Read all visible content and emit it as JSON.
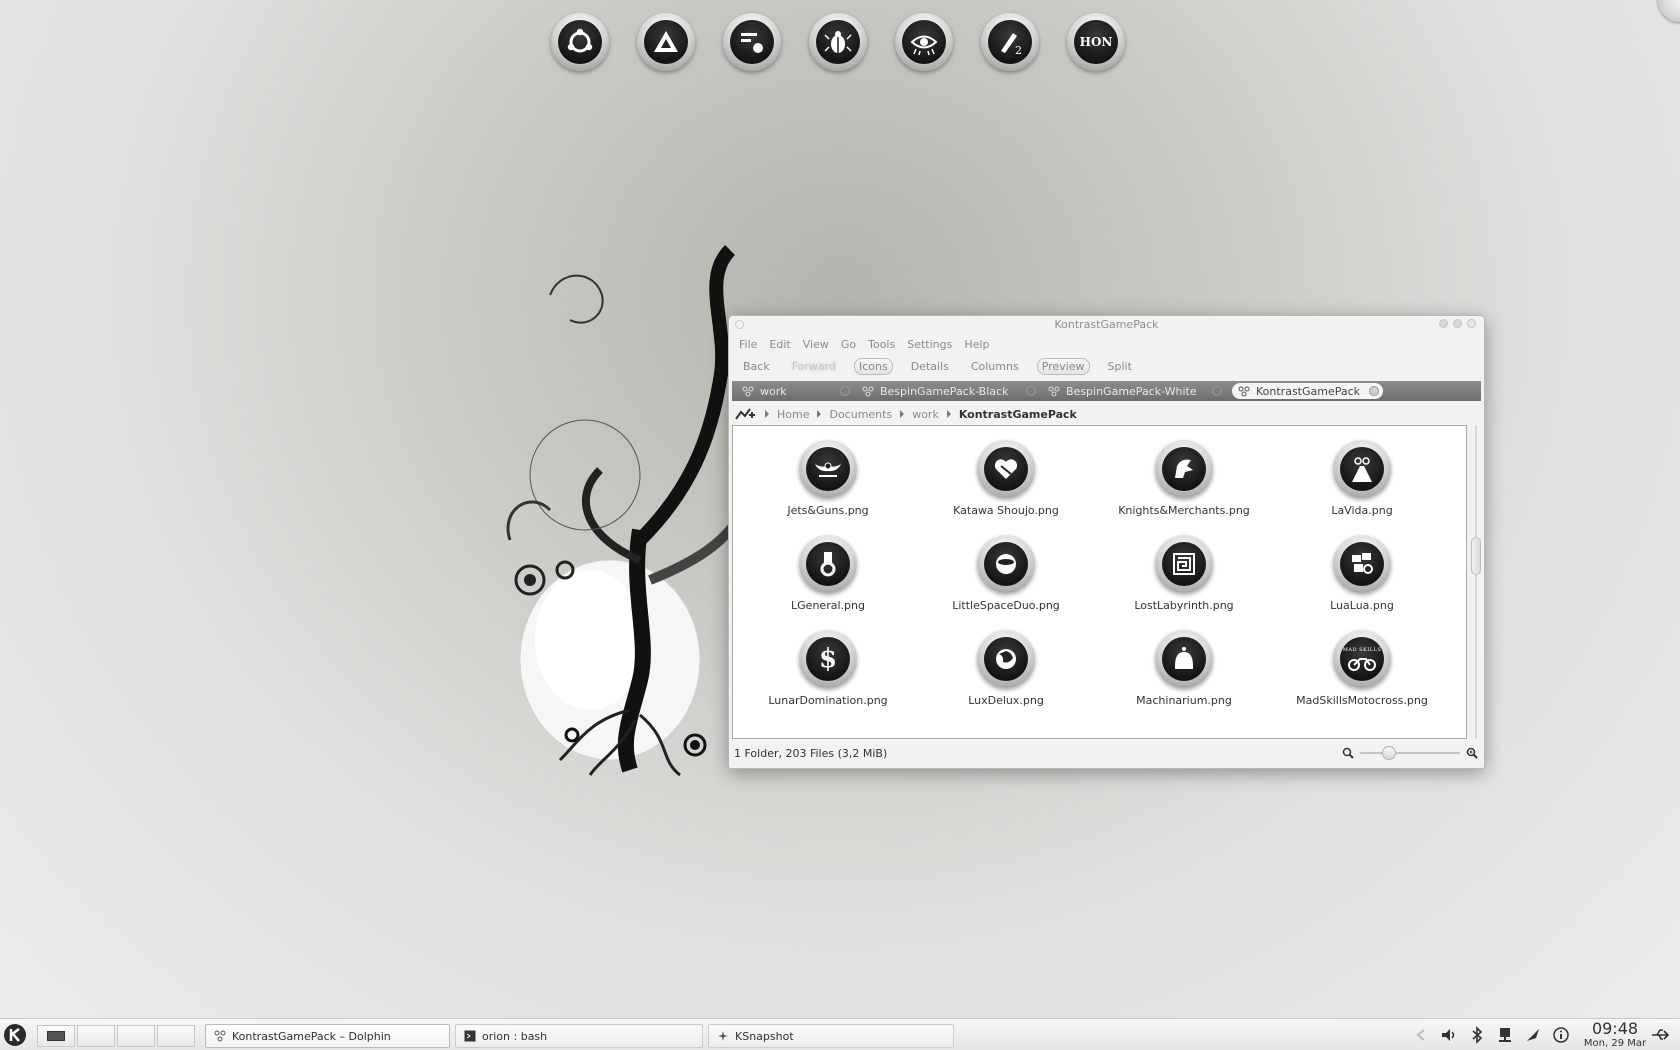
{
  "launcher": [
    {
      "name": "ubuntu-launcher-icon"
    },
    {
      "name": "triangle-launcher-icon"
    },
    {
      "name": "panel-launcher-icon"
    },
    {
      "name": "scarab-launcher-icon"
    },
    {
      "name": "eye-launcher-icon"
    },
    {
      "name": "rocket-2-launcher-icon"
    },
    {
      "name": "hon-launcher-icon",
      "text": "HON"
    }
  ],
  "window": {
    "title": "KontrastGamePack",
    "menu": [
      "File",
      "Edit",
      "View",
      "Go",
      "Tools",
      "Settings",
      "Help"
    ],
    "toolbar": {
      "back": "Back",
      "forward": "Forward",
      "icons": "Icons",
      "details": "Details",
      "columns": "Columns",
      "preview": "Preview",
      "split": "Split"
    },
    "tabs": [
      {
        "label": "work"
      },
      {
        "label": "BespinGamePack-Black"
      },
      {
        "label": "BespinGamePack-White"
      },
      {
        "label": "KontrastGamePack"
      }
    ],
    "breadcrumb": [
      "Home",
      "Documents",
      "work",
      "KontrastGamePack"
    ],
    "files": [
      {
        "name": "Jets&Guns.png",
        "icon": "wings-sword-icon"
      },
      {
        "name": "Katawa Shoujo.png",
        "icon": "heart-icon"
      },
      {
        "name": "Knights&Merchants.png",
        "icon": "knight-helmet-icon"
      },
      {
        "name": "LaVida.png",
        "icon": "road-icon"
      },
      {
        "name": "LGeneral.png",
        "icon": "medal-icon"
      },
      {
        "name": "LittleSpaceDuo.png",
        "icon": "planet-ship-icon"
      },
      {
        "name": "LostLabyrinth.png",
        "icon": "labyrinth-icon"
      },
      {
        "name": "LuaLua.png",
        "icon": "blocks-gear-icon"
      },
      {
        "name": "LunarDomination.png",
        "icon": "dollar-icon",
        "glyph": "$"
      },
      {
        "name": "LuxDelux.png",
        "icon": "globe-icon"
      },
      {
        "name": "Machinarium.png",
        "icon": "robot-head-icon"
      },
      {
        "name": "MadSkillsMotocross.png",
        "icon": "motorbike-icon",
        "caption": "MAD SKILLS"
      }
    ],
    "status": "1 Folder, 203 Files (3,2 MiB)",
    "zoom_fraction": 0.25
  },
  "taskbar": {
    "tasks": [
      {
        "label": "KontrastGamePack – Dolphin",
        "icon": "dolphin-network-icon"
      },
      {
        "label": "orion : bash",
        "icon": "terminal-icon"
      },
      {
        "label": "KSnapshot",
        "icon": "ksnapshot-icon"
      }
    ],
    "tray": [
      "tray-arrow-icon",
      "volume-icon",
      "bluetooth-icon",
      "network-icon",
      "klipper-icon",
      "info-icon"
    ],
    "clock": {
      "time": "09:48",
      "date": "Mon, 29 Mar"
    }
  },
  "colors": {
    "accent": "#6e6e6e",
    "text": "#333333",
    "muted": "#8a8a8a"
  }
}
